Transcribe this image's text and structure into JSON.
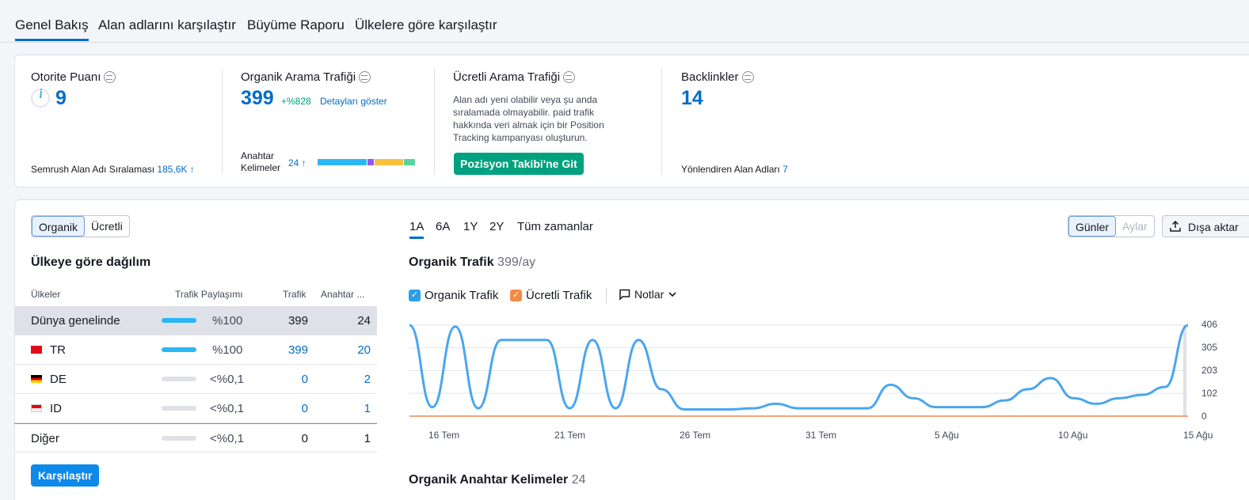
{
  "tabs": [
    "Genel Bakış",
    "Alan adlarını karşılaştır",
    "Büyüme Raporu",
    "Ülkelere göre karşılaştır"
  ],
  "metrics": {
    "authority": {
      "title": "Otorite Puanı",
      "value": "9",
      "rank_label": "Semrush Alan Adı Sıralaması",
      "rank_value": "185,6K ↑"
    },
    "organic": {
      "title": "Organik Arama Trafiği",
      "value": "399",
      "change": "+%828",
      "details_link": "Detayları göster",
      "kw_label_1": "Anahtar",
      "kw_label_2": "Kelimeler",
      "kw_value": "24 ↑"
    },
    "paid": {
      "title": "Ücretli Arama Trafiği",
      "message_lines": [
        "Alan adı yeni olabilir veya şu anda",
        "sıralamada olmayabilir. paid trafik",
        "hakkında veri almak için bir Position",
        "Tracking kampanyası oluşturun."
      ],
      "button": "Pozisyon Takibi'ne Git"
    },
    "backlinks": {
      "title": "Backlinkler",
      "value": "14",
      "ref_label": "Yönlendiren Alan Adları",
      "ref_value": "7"
    }
  },
  "kw_bar_fractions": {
    "blue": 0.52,
    "purple": 0.06,
    "orange": 0.3,
    "green": 0.12
  },
  "left_panel": {
    "toggle": [
      "Organik",
      "Ücretli"
    ],
    "title": "Ülkeye göre dağılım",
    "headers": [
      "Ülkeler",
      "Trafik Paylaşımı",
      "Trafik",
      "Anahtar ..."
    ],
    "rows": [
      {
        "country": "Dünya genelinde",
        "share": "%100",
        "traffic": "399",
        "keywords": "24",
        "share_fraction": 1
      },
      {
        "country": "TR",
        "share": "%100",
        "traffic": "399",
        "keywords": "20",
        "share_fraction": 1
      },
      {
        "country": "DE",
        "share": "<%0,1",
        "traffic": "0",
        "keywords": "2",
        "share_fraction": 0
      },
      {
        "country": "ID",
        "share": "<%0,1",
        "traffic": "0",
        "keywords": "1",
        "share_fraction": 0
      },
      {
        "country": "Diğer",
        "share": "<%0,1",
        "traffic": "0",
        "keywords": "1",
        "share_fraction": 0
      }
    ],
    "compare_button": "Karşılaştır"
  },
  "periods": [
    "1A",
    "6A",
    "1Y",
    "2Y",
    "Tüm zamanlar"
  ],
  "granularity": [
    "Günler",
    "Aylar"
  ],
  "export_label": "Dışa aktar",
  "chart_header": {
    "title": "Organik Trafik",
    "value": "399/ay"
  },
  "legend": {
    "organic": "Organik Trafik",
    "paid": "Ücretli Trafik",
    "notes": "Notlar"
  },
  "keywords_section": {
    "title": "Organik Anahtar Kelimeler",
    "value": "24"
  },
  "colors": {
    "accent": "#006dca",
    "organic_line": "#4aa6ee",
    "paid_line": "#f3a47f",
    "button_green": "#00a17f"
  },
  "chart_data": {
    "type": "line",
    "x": [
      "16 Tem",
      "21 Tem",
      "26 Tem",
      "31 Tem",
      "5 Ağu",
      "10 Ağu",
      "15 Ağu"
    ],
    "x_tick_labels": [
      "16 Tem",
      "21 Tem",
      "26 Tem",
      "31 Tem",
      "5 Ağu",
      "10 Ağu",
      "15 Ağu"
    ],
    "y_tick_labels": [
      "0",
      "102",
      "203",
      "305",
      "406"
    ],
    "ylim": [
      0,
      406
    ],
    "series": [
      {
        "name": "Organik Trafik",
        "values": [
          406,
          40,
          400,
          35,
          340,
          340,
          340,
          35,
          340,
          35,
          340,
          120,
          30,
          30,
          30,
          35,
          55,
          35,
          35,
          35,
          35,
          140,
          80,
          40,
          40,
          40,
          70,
          120,
          170,
          80,
          55,
          80,
          95,
          130,
          406
        ]
      },
      {
        "name": "Ücretli Trafik",
        "values": [
          0,
          0,
          0,
          0,
          0,
          0,
          0,
          0,
          0,
          0,
          0,
          0,
          0,
          0,
          0,
          0,
          0,
          0,
          0,
          0,
          0,
          0,
          0,
          0,
          0,
          0,
          0,
          0,
          0,
          0,
          0,
          0,
          0,
          0,
          0
        ]
      }
    ],
    "grid": true
  }
}
